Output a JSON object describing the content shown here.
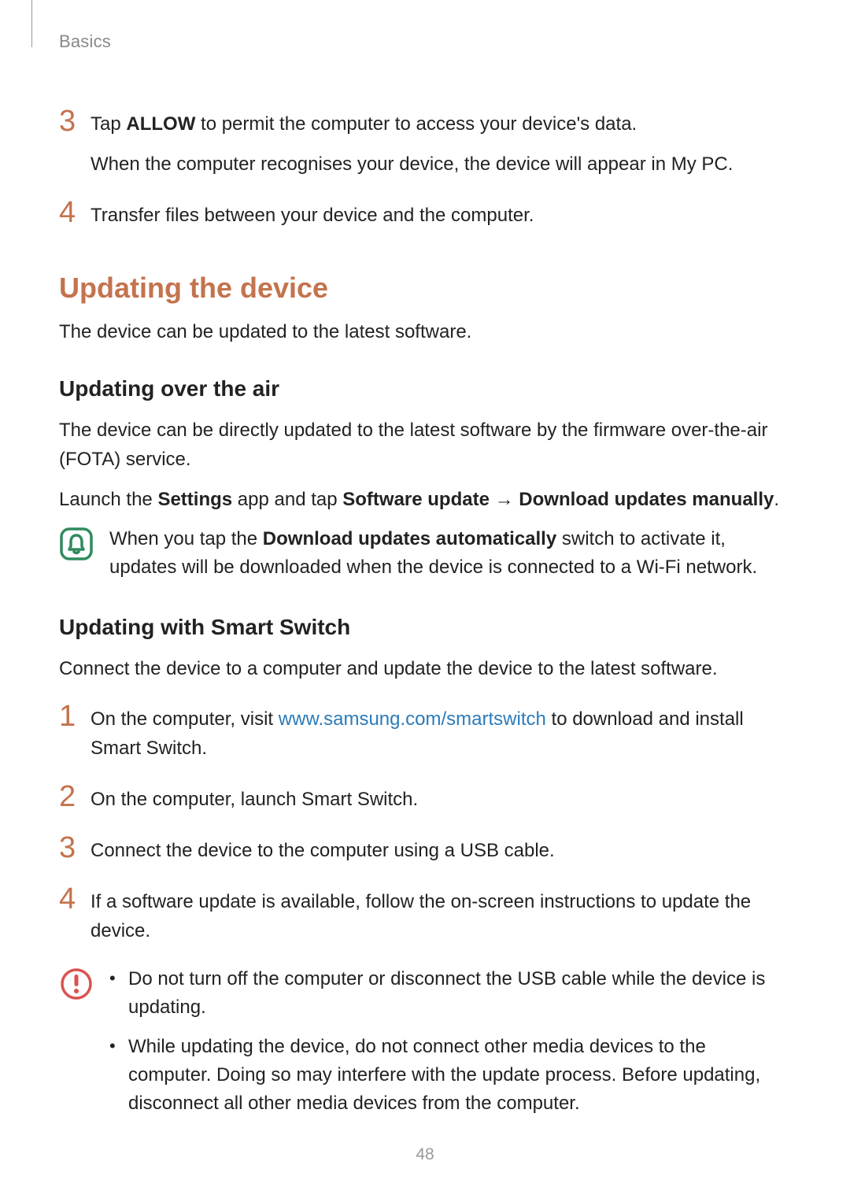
{
  "header": {
    "section": "Basics"
  },
  "top_steps": [
    {
      "num": "3",
      "lines": [
        {
          "pre": "Tap ",
          "bold": "ALLOW",
          "post": " to permit the computer to access your device's data."
        },
        {
          "plain": "When the computer recognises your device, the device will appear in My PC."
        }
      ]
    },
    {
      "num": "4",
      "lines": [
        {
          "plain": "Transfer files between your device and the computer."
        }
      ]
    }
  ],
  "section1": {
    "title": "Updating the device",
    "intro": "The device can be updated to the latest software."
  },
  "section1a": {
    "title": "Updating over the air",
    "p1": "The device can be directly updated to the latest software by the firmware over-the-air (FOTA) service.",
    "p2_pre": "Launch the ",
    "p2_b1": "Settings",
    "p2_mid": " app and tap ",
    "p2_b2": "Software update",
    "p2_arrow": " → ",
    "p2_b3": "Download updates manually",
    "p2_end": ".",
    "note_pre": "When you tap the ",
    "note_bold": "Download updates automatically",
    "note_post": " switch to activate it, updates will be downloaded when the device is connected to a Wi-Fi network."
  },
  "section1b": {
    "title": "Updating with Smart Switch",
    "intro": "Connect the device to a computer and update the device to the latest software.",
    "steps": [
      {
        "num": "1",
        "pre": "On the computer, visit ",
        "link": "www.samsung.com/smartswitch",
        "post": " to download and install Smart Switch."
      },
      {
        "num": "2",
        "plain": "On the computer, launch Smart Switch."
      },
      {
        "num": "3",
        "plain": "Connect the device to the computer using a USB cable."
      },
      {
        "num": "4",
        "plain": "If a software update is available, follow the on-screen instructions to update the device."
      }
    ],
    "warn": [
      "Do not turn off the computer or disconnect the USB cable while the device is updating.",
      "While updating the device, do not connect other media devices to the computer. Doing so may interfere with the update process. Before updating, disconnect all other media devices from the computer."
    ]
  },
  "page_number": "48"
}
